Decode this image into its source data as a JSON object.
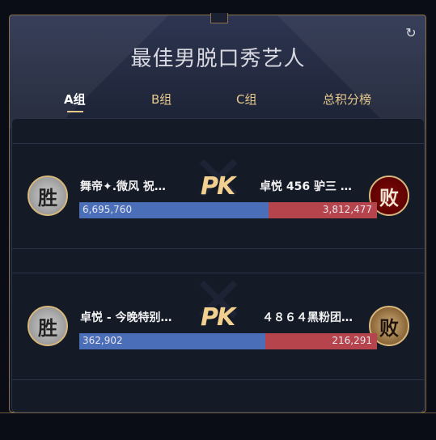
{
  "app": {
    "title": "最佳男脱口秀艺人"
  },
  "tabs": [
    {
      "label": "A组",
      "active": true
    },
    {
      "label": "B组",
      "active": false
    },
    {
      "label": "C组",
      "active": false
    },
    {
      "label": "总积分榜",
      "active": false
    }
  ],
  "matches": [
    {
      "left_badge": "胜",
      "left_name": "舞帝✦.微风 祝…",
      "left_score": "6,695,760",
      "pk_label": "PK",
      "right_name": "卓悦 456 驴三 …",
      "right_score": "3,812,477",
      "right_badge": "败",
      "left_share": 0.637,
      "right_share": 0.363
    },
    {
      "left_badge": "胜",
      "left_name": "卓悦 - 今晚特别…",
      "left_score": "362,902",
      "pk_label": "PK",
      "right_name": "４８６４黑粉团…",
      "right_score": "216,291",
      "right_badge": "败",
      "left_share": 0.626,
      "right_share": 0.374
    }
  ],
  "icons": {
    "refresh": "refresh-icon"
  }
}
